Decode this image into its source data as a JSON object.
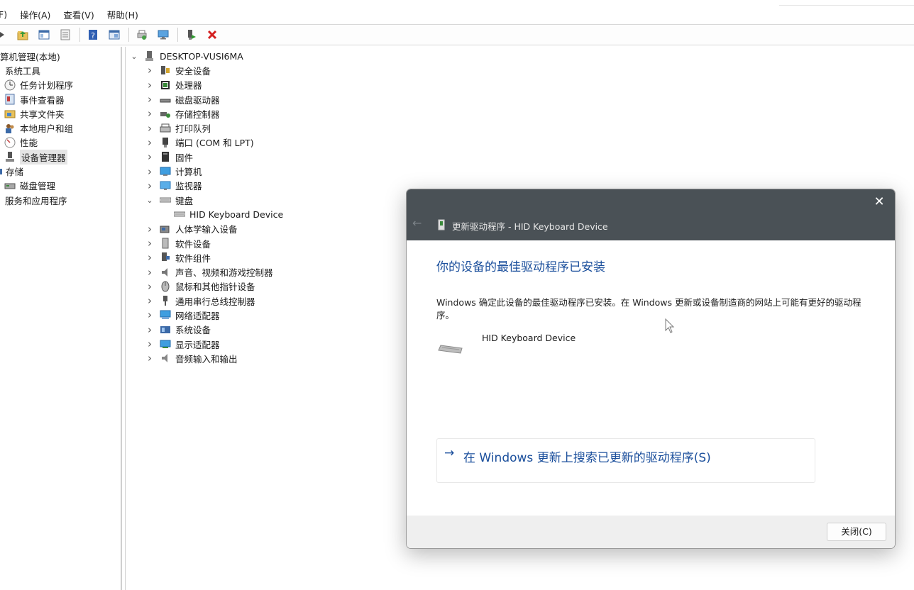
{
  "menubar": {
    "items": [
      {
        "label": "F)"
      },
      {
        "label": "操作(A)"
      },
      {
        "label": "查看(V)"
      },
      {
        "label": "帮助(H)"
      }
    ]
  },
  "toolbar": {
    "icons": [
      "back-arrow-icon",
      "folder-up-icon",
      "console-tree-icon",
      "properties-icon",
      "help-icon",
      "pane-icon",
      "print-icon",
      "monitor-icon",
      "enable-device-icon",
      "uninstall-icon"
    ]
  },
  "left_tree": {
    "items": [
      {
        "label": "算机管理(本地)",
        "icon": "computer-management-icon",
        "indent": 0
      },
      {
        "label": "系统工具",
        "icon": "",
        "indent": 1
      },
      {
        "label": "任务计划程序",
        "icon": "clock-icon",
        "indent": 2
      },
      {
        "label": "事件查看器",
        "icon": "event-viewer-icon",
        "indent": 2
      },
      {
        "label": "共享文件夹",
        "icon": "shared-folder-icon",
        "indent": 2
      },
      {
        "label": "本地用户和组",
        "icon": "users-icon",
        "indent": 2
      },
      {
        "label": "性能",
        "icon": "performance-icon",
        "indent": 2
      },
      {
        "label": "设备管理器",
        "icon": "device-manager-icon",
        "indent": 2,
        "selected": true
      },
      {
        "label": "存储",
        "icon": "",
        "indent": 1
      },
      {
        "label": "磁盘管理",
        "icon": "disk-management-icon",
        "indent": 2
      },
      {
        "label": "服务和应用程序",
        "icon": "",
        "indent": 1
      }
    ]
  },
  "device_tree": {
    "root": "DESKTOP-VUSI6MA",
    "items": [
      {
        "label": "安全设备",
        "icon": "security-device-icon",
        "expanded": false
      },
      {
        "label": "处理器",
        "icon": "processor-icon",
        "expanded": false
      },
      {
        "label": "磁盘驱动器",
        "icon": "disk-drive-icon",
        "expanded": false
      },
      {
        "label": "存储控制器",
        "icon": "storage-controller-icon",
        "expanded": false
      },
      {
        "label": "打印队列",
        "icon": "printer-icon",
        "expanded": false
      },
      {
        "label": "端口 (COM 和 LPT)",
        "icon": "port-icon",
        "expanded": false
      },
      {
        "label": "固件",
        "icon": "firmware-icon",
        "expanded": false
      },
      {
        "label": "计算机",
        "icon": "computer-icon",
        "expanded": false
      },
      {
        "label": "监视器",
        "icon": "monitor-icon",
        "expanded": false
      },
      {
        "label": "键盘",
        "icon": "keyboard-icon",
        "expanded": true
      },
      {
        "label": "HID Keyboard Device",
        "icon": "keyboard-icon",
        "child": true
      },
      {
        "label": "人体学输入设备",
        "icon": "hid-icon",
        "expanded": false
      },
      {
        "label": "软件设备",
        "icon": "software-device-icon",
        "expanded": false
      },
      {
        "label": "软件组件",
        "icon": "software-component-icon",
        "expanded": false
      },
      {
        "label": "声音、视频和游戏控制器",
        "icon": "speaker-icon",
        "expanded": false
      },
      {
        "label": "鼠标和其他指针设备",
        "icon": "mouse-icon",
        "expanded": false
      },
      {
        "label": "通用串行总线控制器",
        "icon": "usb-icon",
        "expanded": false
      },
      {
        "label": "网络适配器",
        "icon": "network-adapter-icon",
        "expanded": false
      },
      {
        "label": "系统设备",
        "icon": "system-device-icon",
        "expanded": false
      },
      {
        "label": "显示适配器",
        "icon": "display-adapter-icon",
        "expanded": false
      },
      {
        "label": "音频输入和输出",
        "icon": "audio-io-icon",
        "expanded": false
      }
    ]
  },
  "dialog": {
    "title": "更新驱动程序 - HID Keyboard Device",
    "heading": "你的设备的最佳驱动程序已安装",
    "description": "Windows 确定此设备的最佳驱动程序已安装。在 Windows 更新或设备制造商的网站上可能有更好的驱动程序。",
    "device_name": "HID Keyboard Device",
    "link_arrow": "→",
    "link": "在 Windows 更新上搜索已更新的驱动程序(S)",
    "close_button": "关闭(C)",
    "close_glyph": "✕",
    "back_glyph": "←",
    "colors": {
      "titlebar": "#4a5156",
      "link": "#1b4f9c",
      "footer": "#efefef"
    }
  }
}
